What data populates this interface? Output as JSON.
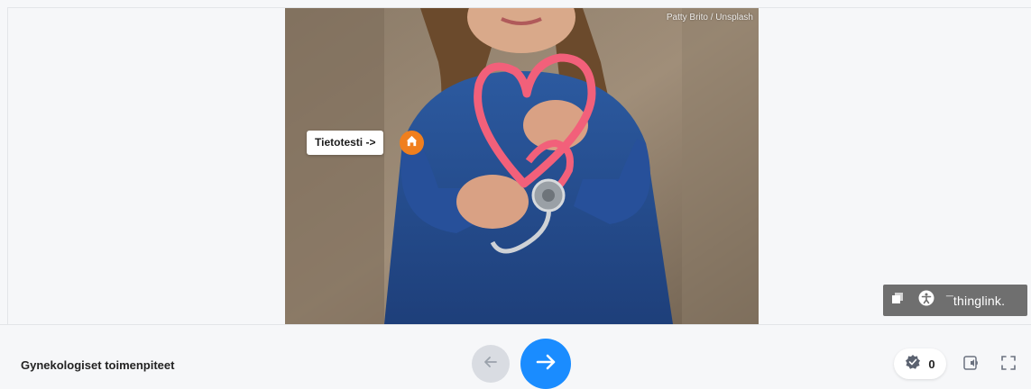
{
  "image": {
    "credit": "Patty Brito / Unsplash"
  },
  "tag": {
    "label": "Tietotesti ->",
    "icon": "home-icon",
    "color": "#f07f1e"
  },
  "toolbar": {
    "layers_icon": "layers-icon",
    "accessibility_icon": "accessibility-icon",
    "logo_text": "¯thinglink."
  },
  "footer": {
    "title": "Gynekologiset toimenpiteet",
    "prev_icon": "arrow-left-icon",
    "next_icon": "arrow-right-icon",
    "next_color": "#1a8cff",
    "score": {
      "icon": "badge-check-icon",
      "count": "0"
    },
    "audio_icon": "audio-transcript-icon",
    "fullscreen_icon": "fullscreen-icon"
  }
}
